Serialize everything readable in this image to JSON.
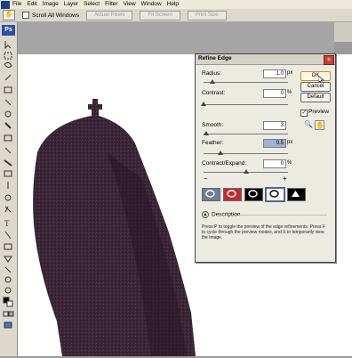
{
  "menubar": {
    "items": [
      "File",
      "Edit",
      "Image",
      "Layer",
      "Select",
      "Filter",
      "View",
      "Window",
      "Help"
    ]
  },
  "options_bar": {
    "scroll_all_label": "Scroll All Windows",
    "actual_pixels_label": "Actual Pixels",
    "fit_screen_label": "Fit Screen",
    "print_size_label": "Print Size"
  },
  "toolbox": {
    "logo_text": "Ps"
  },
  "dialog": {
    "title": "Refine Edge",
    "close_label": "×",
    "radius": {
      "label": "Radius:",
      "value": "1.0",
      "unit": "px",
      "level": 0.1
    },
    "contrast": {
      "label": "Contrast:",
      "value": "0",
      "unit": "%",
      "level": 0.0
    },
    "smooth": {
      "label": "Smooth:",
      "value": "3",
      "level": 0.03
    },
    "feather": {
      "label": "Feather:",
      "value": "9.5",
      "unit": "px",
      "level": 0.2
    },
    "contract": {
      "label": "Contract/Expand:",
      "value": "0",
      "unit": "%",
      "level": 0.5,
      "minus": "−",
      "plus": "+"
    },
    "buttons": {
      "ok": "OK",
      "cancel": "Cancel",
      "default": "Default"
    },
    "preview_label": "Preview",
    "description_label": "Description",
    "description_text": "Press P to toggle the preview of the edge refinements. Press F to cycle through the preview modes, and X to temporarily view the image."
  },
  "colors": {
    "dialog_bg": "#ecebe2",
    "tower_fill": "#3a2536",
    "close_red": "#c9413a",
    "mode_blue": "#2a6ac9"
  }
}
